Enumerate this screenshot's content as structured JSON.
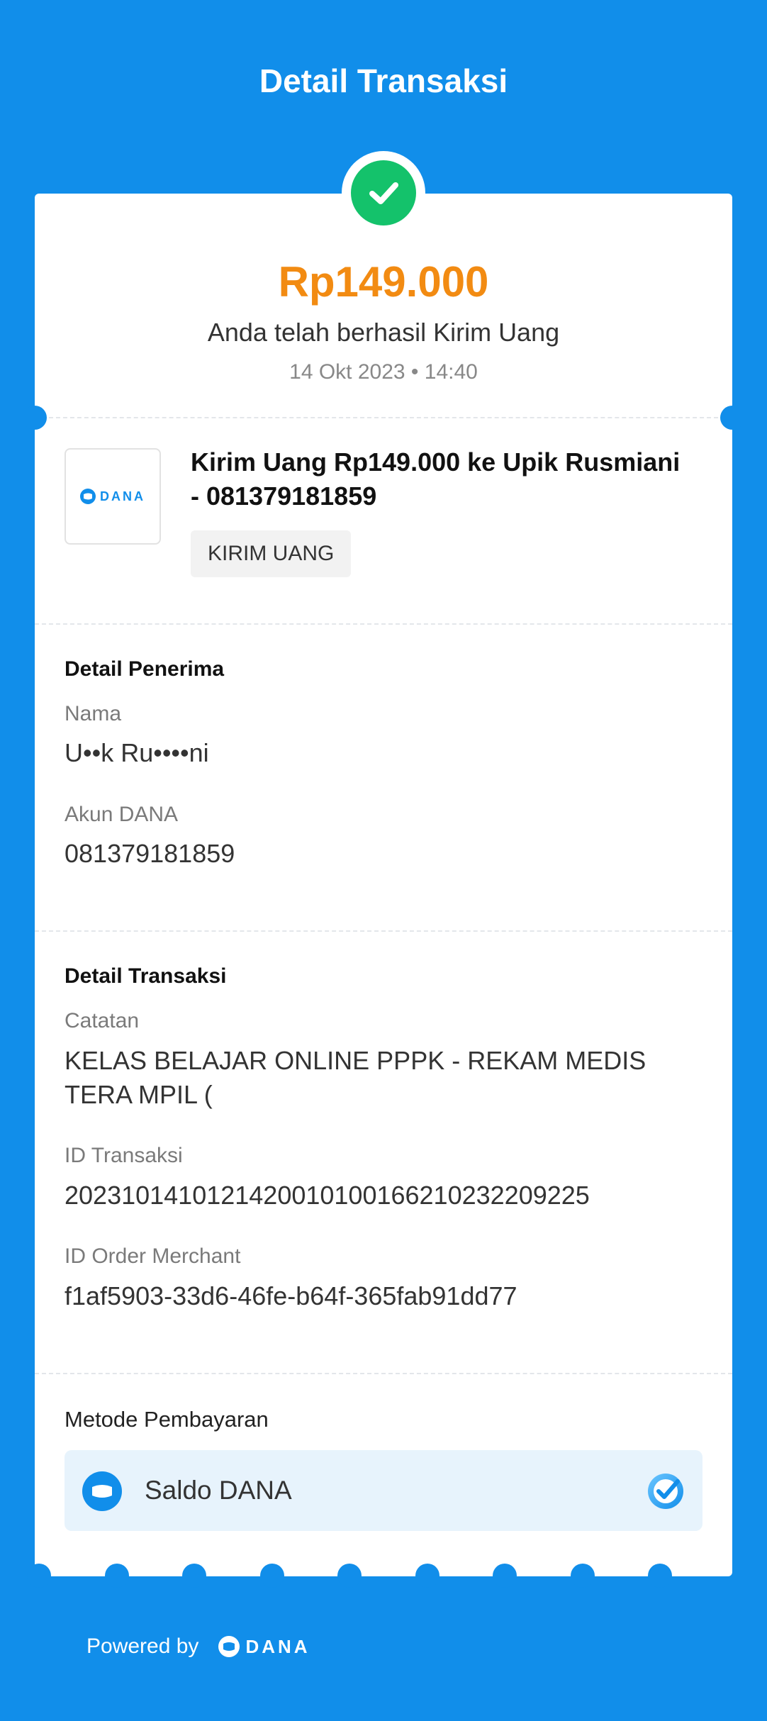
{
  "header": {
    "title": "Detail Transaksi"
  },
  "summary": {
    "amount": "Rp149.000",
    "message": "Anda telah berhasil Kirim Uang",
    "datetime": "14 Okt 2023 • 14:40",
    "status_icon": "check-circle-icon",
    "status_color": "#14c26b",
    "amount_color": "#f28b12"
  },
  "product": {
    "logo_text": "DANA",
    "title": "Kirim Uang Rp149.000 ke Upik Rusmiani - 081379181859",
    "tag": "KIRIM UANG"
  },
  "recipient": {
    "section_title": "Detail Penerima",
    "name_label": "Nama",
    "name_value": "U••k Ru••••ni",
    "account_label": "Akun DANA",
    "account_value": "081379181859"
  },
  "transaction": {
    "section_title": "Detail Transaksi",
    "note_label": "Catatan",
    "note_value": "KELAS BELAJAR ONLINE PPPK - REKAM MEDIS TERA MPIL (",
    "id_label": "ID Transaksi",
    "id_value": "2023101410121420010100166210232209225",
    "order_label": "ID Order Merchant",
    "order_value": "f1af5903-33d6-46fe-b64f-365fab91dd77"
  },
  "payment": {
    "title": "Metode Pembayaran",
    "method": "Saldo DANA",
    "selected": true
  },
  "footer": {
    "powered_by": "Powered by",
    "brand": "DANA"
  },
  "colors": {
    "brand_blue": "#118eea",
    "pay_box_bg": "#e7f3fc"
  }
}
